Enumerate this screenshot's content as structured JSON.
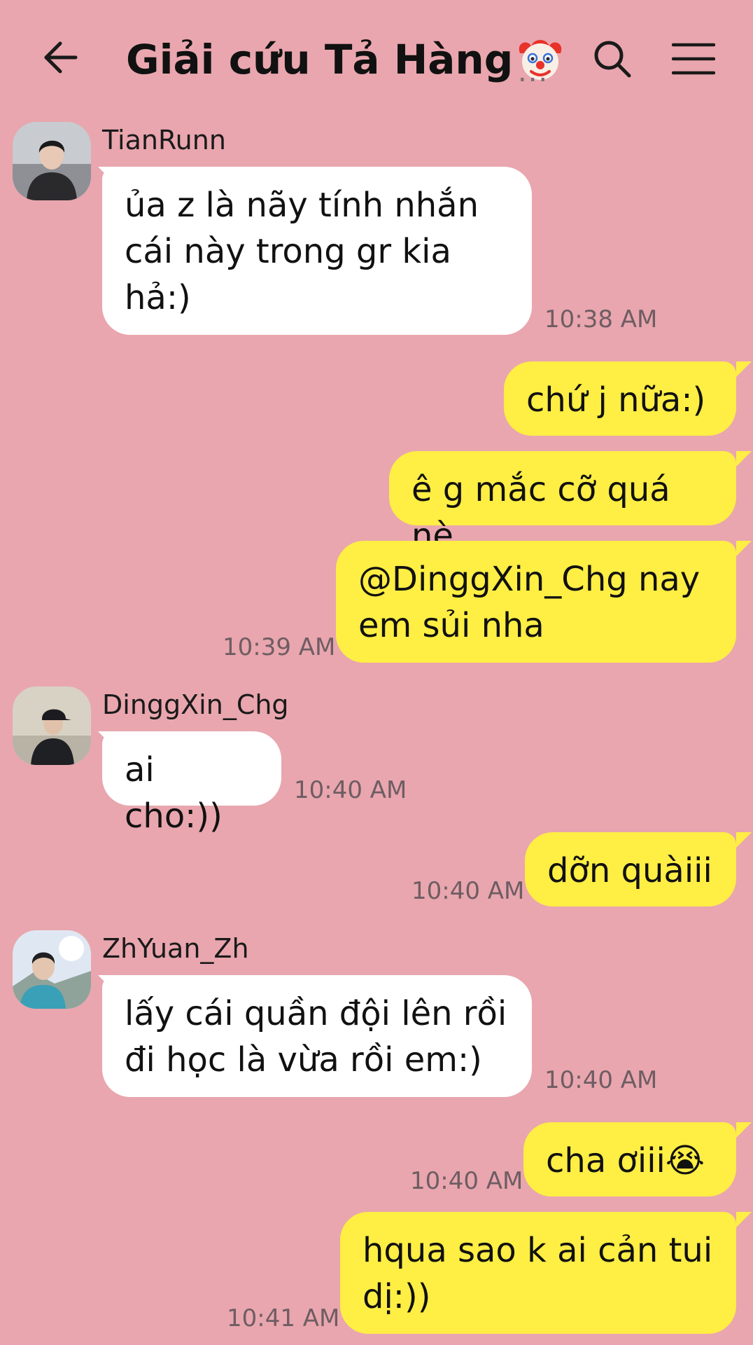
{
  "header": {
    "title": "Giải cứu Tả Hàng",
    "title_emoji": "clown-face",
    "more": "...",
    "icons": {
      "back": "back-arrow-icon",
      "search": "search-icon",
      "menu": "menu-icon"
    }
  },
  "colors": {
    "background": "#e9a6ae",
    "incoming_bubble": "#ffffff",
    "outgoing_bubble": "#ffee44"
  },
  "messages": [
    {
      "direction": "in",
      "sender": "TianRunn",
      "text": "ủa z là nãy tính nhắn cái này trong gr kia hả:)",
      "time": "10:38 AM"
    },
    {
      "direction": "out",
      "text": "chứ j nữa:)",
      "time": ""
    },
    {
      "direction": "out",
      "text": "ê g mắc cỡ quá nè",
      "time": ""
    },
    {
      "direction": "out",
      "text": "@DinggXin_Chg nay em sủi nha",
      "time": "10:39 AM"
    },
    {
      "direction": "in",
      "sender": "DinggXin_Chg",
      "text": "ai cho:))",
      "time": "10:40 AM"
    },
    {
      "direction": "out",
      "text": "dỡn quàiii",
      "time": "10:40 AM"
    },
    {
      "direction": "in",
      "sender": "ZhYuan_Zh",
      "text": "lấy cái quần đội lên rồi đi học là vừa rồi em:)",
      "time": "10:40 AM"
    },
    {
      "direction": "out",
      "text": "cha ơiii😭",
      "time": "10:40 AM"
    },
    {
      "direction": "out",
      "text": "hqua sao k ai cản tui dị:))",
      "time": "10:41 AM"
    }
  ]
}
